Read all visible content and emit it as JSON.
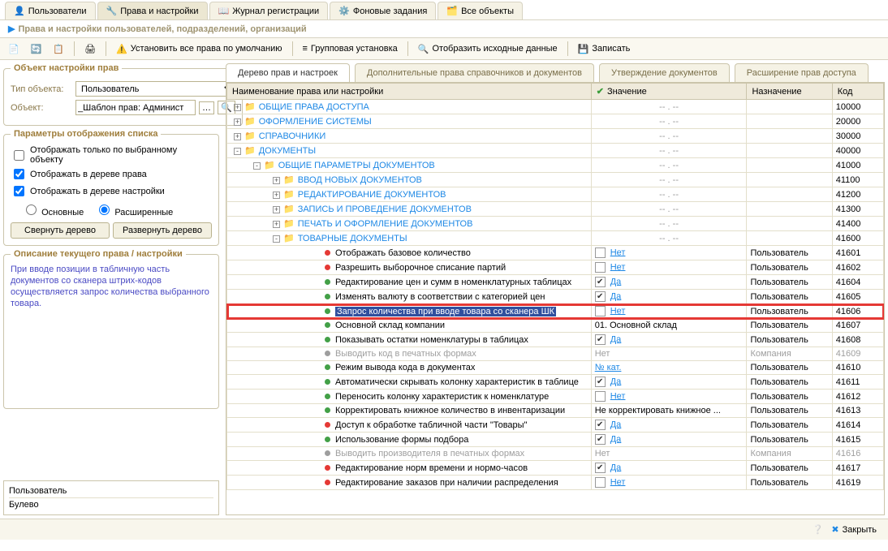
{
  "app_tabs": [
    {
      "label": "Пользователи"
    },
    {
      "label": "Права и настройки",
      "active": true
    },
    {
      "label": "Журнал регистрации"
    },
    {
      "label": "Фоновые задания"
    },
    {
      "label": "Все объекты"
    }
  ],
  "subtitle": "Права и настройки пользователей, подразделений, организаций",
  "toolbar": {
    "set_default": "Установить все права по умолчанию",
    "group_set": "Групповая установка",
    "show_original": "Отобразить исходные данные",
    "save": "Записать"
  },
  "settings_object": {
    "legend": "Объект настройки прав",
    "type_lbl": "Тип объекта:",
    "type_val": "Пользователь",
    "obj_lbl": "Объект:",
    "obj_val": "_Шаблон прав: Админист"
  },
  "display_params": {
    "legend": "Параметры отображения списка",
    "chk1": "Отображать только по выбранному объекту",
    "chk2": "Отображать в дереве права",
    "chk3": "Отображать в дереве настройки",
    "radio1": "Основные",
    "radio2": "Расширенные",
    "btn_collapse": "Свернуть дерево",
    "btn_expand": "Развернуть дерево"
  },
  "description": {
    "legend": "Описание текущего права / настройки",
    "text": "При вводе позиции в табличную часть документов со сканера штрих-кодов осуществляется запрос количества выбранного товара."
  },
  "meta": {
    "line1": "Пользователь",
    "line2": "Булево"
  },
  "sub_tabs": [
    {
      "label": "Дерево прав и настроек",
      "active": true
    },
    {
      "label": "Дополнительные права справочников и документов"
    },
    {
      "label": "Утверждение документов"
    },
    {
      "label": "Расширение прав доступа"
    }
  ],
  "cols": {
    "name": "Наименование права или настройки",
    "val": "Значение",
    "nazn": "Назначение",
    "kod": "Код"
  },
  "rows": [
    {
      "type": "folder",
      "exp": "+",
      "indent": 0,
      "name": "ОБЩИЕ ПРАВА ДОСТУПА",
      "kod": "10000"
    },
    {
      "type": "folder",
      "exp": "+",
      "indent": 0,
      "name": "ОФОРМЛЕНИЕ СИСТЕМЫ",
      "kod": "20000"
    },
    {
      "type": "folder",
      "exp": "+",
      "indent": 0,
      "name": "СПРАВОЧНИКИ",
      "kod": "30000"
    },
    {
      "type": "folder",
      "exp": "-",
      "indent": 0,
      "name": "ДОКУМЕНТЫ",
      "kod": "40000"
    },
    {
      "type": "folder",
      "exp": "-",
      "indent": 1,
      "name": "ОБЩИЕ ПАРАМЕТРЫ ДОКУМЕНТОВ",
      "kod": "41000"
    },
    {
      "type": "folder",
      "exp": "+",
      "indent": 2,
      "name": "ВВОД НОВЫХ ДОКУМЕНТОВ",
      "kod": "41100"
    },
    {
      "type": "folder",
      "exp": "+",
      "indent": 2,
      "name": "РЕДАКТИРОВАНИЕ ДОКУМЕНТОВ",
      "kod": "41200"
    },
    {
      "type": "folder",
      "exp": "+",
      "indent": 2,
      "name": "ЗАПИСЬ И ПРОВЕДЕНИЕ ДОКУМЕНТОВ",
      "kod": "41300"
    },
    {
      "type": "folder",
      "exp": "+",
      "indent": 2,
      "name": "ПЕЧАТЬ И ОФОРМЛЕНИЕ ДОКУМЕНТОВ",
      "kod": "41400"
    },
    {
      "type": "folder",
      "exp": "-",
      "indent": 2,
      "name": "ТОВАРНЫЕ ДОКУМЕНТЫ",
      "kod": "41600"
    },
    {
      "type": "leaf",
      "dot": "red",
      "indent": 3,
      "name": "Отображать базовое количество",
      "chk": false,
      "val": "Нет",
      "val_cls": "no",
      "nazn": "Пользователь",
      "kod": "41601"
    },
    {
      "type": "leaf",
      "dot": "red",
      "indent": 3,
      "name": "Разрешить выборочное списание партий",
      "chk": false,
      "val": "Нет",
      "val_cls": "no",
      "nazn": "Пользователь",
      "kod": "41602"
    },
    {
      "type": "leaf",
      "dot": "green",
      "indent": 3,
      "name": "Редактирование цен и сумм в номенклатурных таблицах",
      "chk": true,
      "val": "Да",
      "val_cls": "da",
      "nazn": "Пользователь",
      "kod": "41604"
    },
    {
      "type": "leaf",
      "dot": "green",
      "indent": 3,
      "name": "Изменять валюту в соответствии с категорией цен",
      "chk": true,
      "val": "Да",
      "val_cls": "da",
      "nazn": "Пользователь",
      "kod": "41605"
    },
    {
      "type": "leaf",
      "dot": "green",
      "indent": 3,
      "name": "Запрос количества при вводе товара со сканера ШК",
      "chk": false,
      "val": "Нет",
      "val_cls": "no",
      "nazn": "Пользователь",
      "kod": "41606",
      "hl": true,
      "sel": true
    },
    {
      "type": "leaf",
      "dot": "green",
      "indent": 3,
      "name": "Основной склад компании",
      "val": "01. Основной склад",
      "val_cls": "",
      "nazn": "Пользователь",
      "kod": "41607"
    },
    {
      "type": "leaf",
      "dot": "green",
      "indent": 3,
      "name": "Показывать остатки номенклатуры в таблицах",
      "chk": true,
      "val": "Да",
      "val_cls": "da",
      "nazn": "Пользователь",
      "kod": "41608"
    },
    {
      "type": "leaf",
      "dot": "grey",
      "indent": 3,
      "name": "Выводить код в печатных формах",
      "val": "Нет",
      "val_cls": "",
      "nazn": "Компания",
      "kod": "41609",
      "disabled": true
    },
    {
      "type": "leaf",
      "dot": "green",
      "indent": 3,
      "name": "Режим вывода кода в документах",
      "val": "№ кат.",
      "val_cls": "no",
      "nazn": "Пользователь",
      "kod": "41610"
    },
    {
      "type": "leaf",
      "dot": "green",
      "indent": 3,
      "name": "Автоматически скрывать колонку характеристик в таблице",
      "chk": true,
      "val": "Да",
      "val_cls": "da",
      "nazn": "Пользователь",
      "kod": "41611"
    },
    {
      "type": "leaf",
      "dot": "green",
      "indent": 3,
      "name": "Переносить колонку характеристик к номенклатуре",
      "chk": false,
      "val": "Нет",
      "val_cls": "no",
      "nazn": "Пользователь",
      "kod": "41612"
    },
    {
      "type": "leaf",
      "dot": "green",
      "indent": 3,
      "name": "Корректировать книжное количество в инвентаризации",
      "val": "Не корректировать книжное ...",
      "val_cls": "",
      "nazn": "Пользователь",
      "kod": "41613"
    },
    {
      "type": "leaf",
      "dot": "red",
      "indent": 3,
      "name": "Доступ к обработке табличной части \"Товары\"",
      "chk": true,
      "val": "Да",
      "val_cls": "da",
      "nazn": "Пользователь",
      "kod": "41614"
    },
    {
      "type": "leaf",
      "dot": "green",
      "indent": 3,
      "name": "Использование формы подбора",
      "chk": true,
      "val": "Да",
      "val_cls": "da",
      "nazn": "Пользователь",
      "kod": "41615"
    },
    {
      "type": "leaf",
      "dot": "grey",
      "indent": 3,
      "name": "Выводить производителя в печатных формах",
      "val": "Нет",
      "val_cls": "",
      "nazn": "Компания",
      "kod": "41616",
      "disabled": true
    },
    {
      "type": "leaf",
      "dot": "red",
      "indent": 3,
      "name": "Редактирование норм времени и нормо-часов",
      "chk": true,
      "val": "Да",
      "val_cls": "da",
      "nazn": "Пользователь",
      "kod": "41617"
    },
    {
      "type": "leaf",
      "dot": "red",
      "indent": 3,
      "name": "Редактирование заказов при наличии распределения",
      "chk": false,
      "val": "Нет",
      "val_cls": "no",
      "nazn": "Пользователь",
      "kod": "41619"
    }
  ],
  "footer": {
    "close": "Закрыть"
  }
}
